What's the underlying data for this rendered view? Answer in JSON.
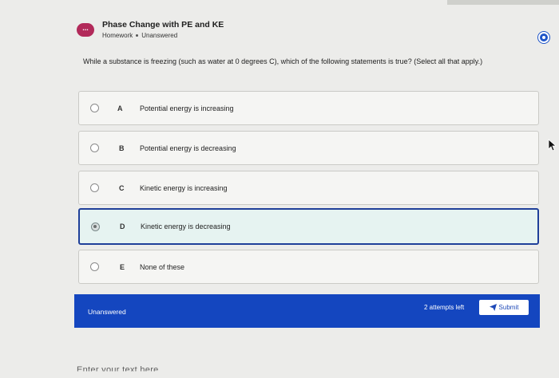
{
  "header": {
    "icon_text": "...",
    "title": "Phase Change with PE and KE",
    "type": "Homework",
    "status": "Unanswered"
  },
  "question": {
    "text": "While a substance is freezing (such as water at 0 degrees C), which of the following statements is true? (Select all that apply.)"
  },
  "options": [
    {
      "letter": "A",
      "text": "Potential energy is increasing"
    },
    {
      "letter": "B",
      "text": "Potential energy is decreasing"
    },
    {
      "letter": "C",
      "text": "Kinetic energy is increasing"
    },
    {
      "letter": "D",
      "text": "Kinetic energy is decreasing",
      "selected": true
    },
    {
      "letter": "E",
      "text": "None of these"
    }
  ],
  "footer": {
    "status": "Unanswered",
    "attempts": "2 attempts left",
    "submit_label": "Submit"
  },
  "editor": {
    "placeholder": "Enter your text here"
  },
  "colors": {
    "accent": "#1446bf",
    "icon_badge": "#b22a5a",
    "selected_bg": "#e6f3f1"
  }
}
